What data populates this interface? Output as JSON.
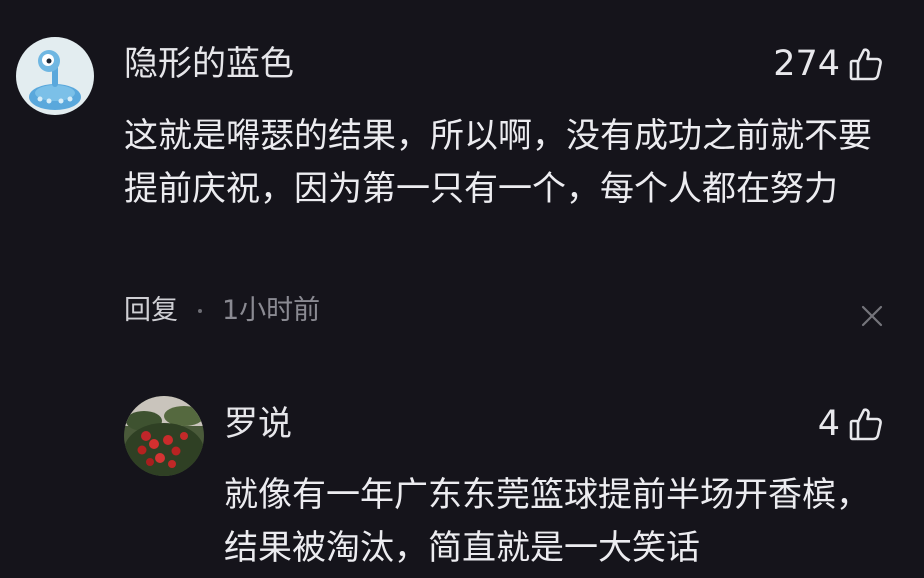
{
  "comments": [
    {
      "username": "隐形的蓝色",
      "likes": "274",
      "text": "这就是嘚瑟的结果，所以啊，没有成功之前就不要提前庆祝，因为第一只有一个，每个人都在努力",
      "reply_label": "回复",
      "time": "1小时前"
    },
    {
      "username": "罗说",
      "likes": "4",
      "text": "就像有一年广东东莞篮球提前半场开香槟，结果被淘汰，简直就是一大笑话"
    }
  ],
  "colors": {
    "background": "#15141b",
    "text": "#ececf0",
    "muted": "#8a8a92",
    "avatar_bg": "#e3edf0",
    "avatar_blue": "#5aa8dc"
  },
  "icons": {
    "like": "thumbs-up-icon",
    "close": "close-icon"
  }
}
